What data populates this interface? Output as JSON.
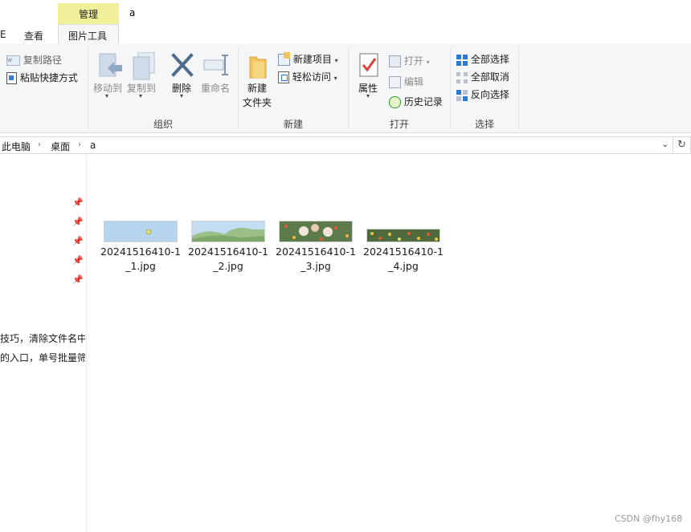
{
  "window": {
    "title": "a",
    "context_group": "管理"
  },
  "tabs": {
    "view": "查看",
    "picture_tools": "图片工具",
    "left_edge": "E"
  },
  "ribbon": {
    "clipboard": {
      "copy_path": "复制路径",
      "paste_shortcut": "粘贴快捷方式"
    },
    "organize": {
      "move_to": "移动到",
      "copy_to": "复制到",
      "delete": "删除",
      "rename": "重命名",
      "group_label": "组织"
    },
    "new": {
      "new_folder_line1": "新建",
      "new_folder_line2": "文件夹",
      "new_item": "新建项目",
      "easy_access": "轻松访问",
      "group_label": "新建"
    },
    "open": {
      "properties": "属性",
      "open": "打开",
      "edit": "编辑",
      "history": "历史记录",
      "group_label": "打开"
    },
    "select": {
      "select_all": "全部选择",
      "select_none": "全部取消",
      "invert": "反向选择",
      "group_label": "选择"
    }
  },
  "address": {
    "crumbs": [
      "此电脑",
      "桌面",
      "a"
    ]
  },
  "left_pane": {
    "text_line1": "技巧，清除文件名中的",
    "text_line2": "的入口，单号批量筛选"
  },
  "files": [
    {
      "name_line1": "20241516410-1",
      "name_line2": "_1.jpg"
    },
    {
      "name_line1": "20241516410-1",
      "name_line2": "_2.jpg"
    },
    {
      "name_line1": "20241516410-1",
      "name_line2": "_3.jpg"
    },
    {
      "name_line1": "20241516410-1",
      "name_line2": "_4.jpg"
    }
  ],
  "watermark": "CSDN @fhy168",
  "colors": {
    "context_tab": "#f0ef9a",
    "ribbon_bg": "#f5f6f7",
    "accent_blue": "#2b79d0"
  }
}
